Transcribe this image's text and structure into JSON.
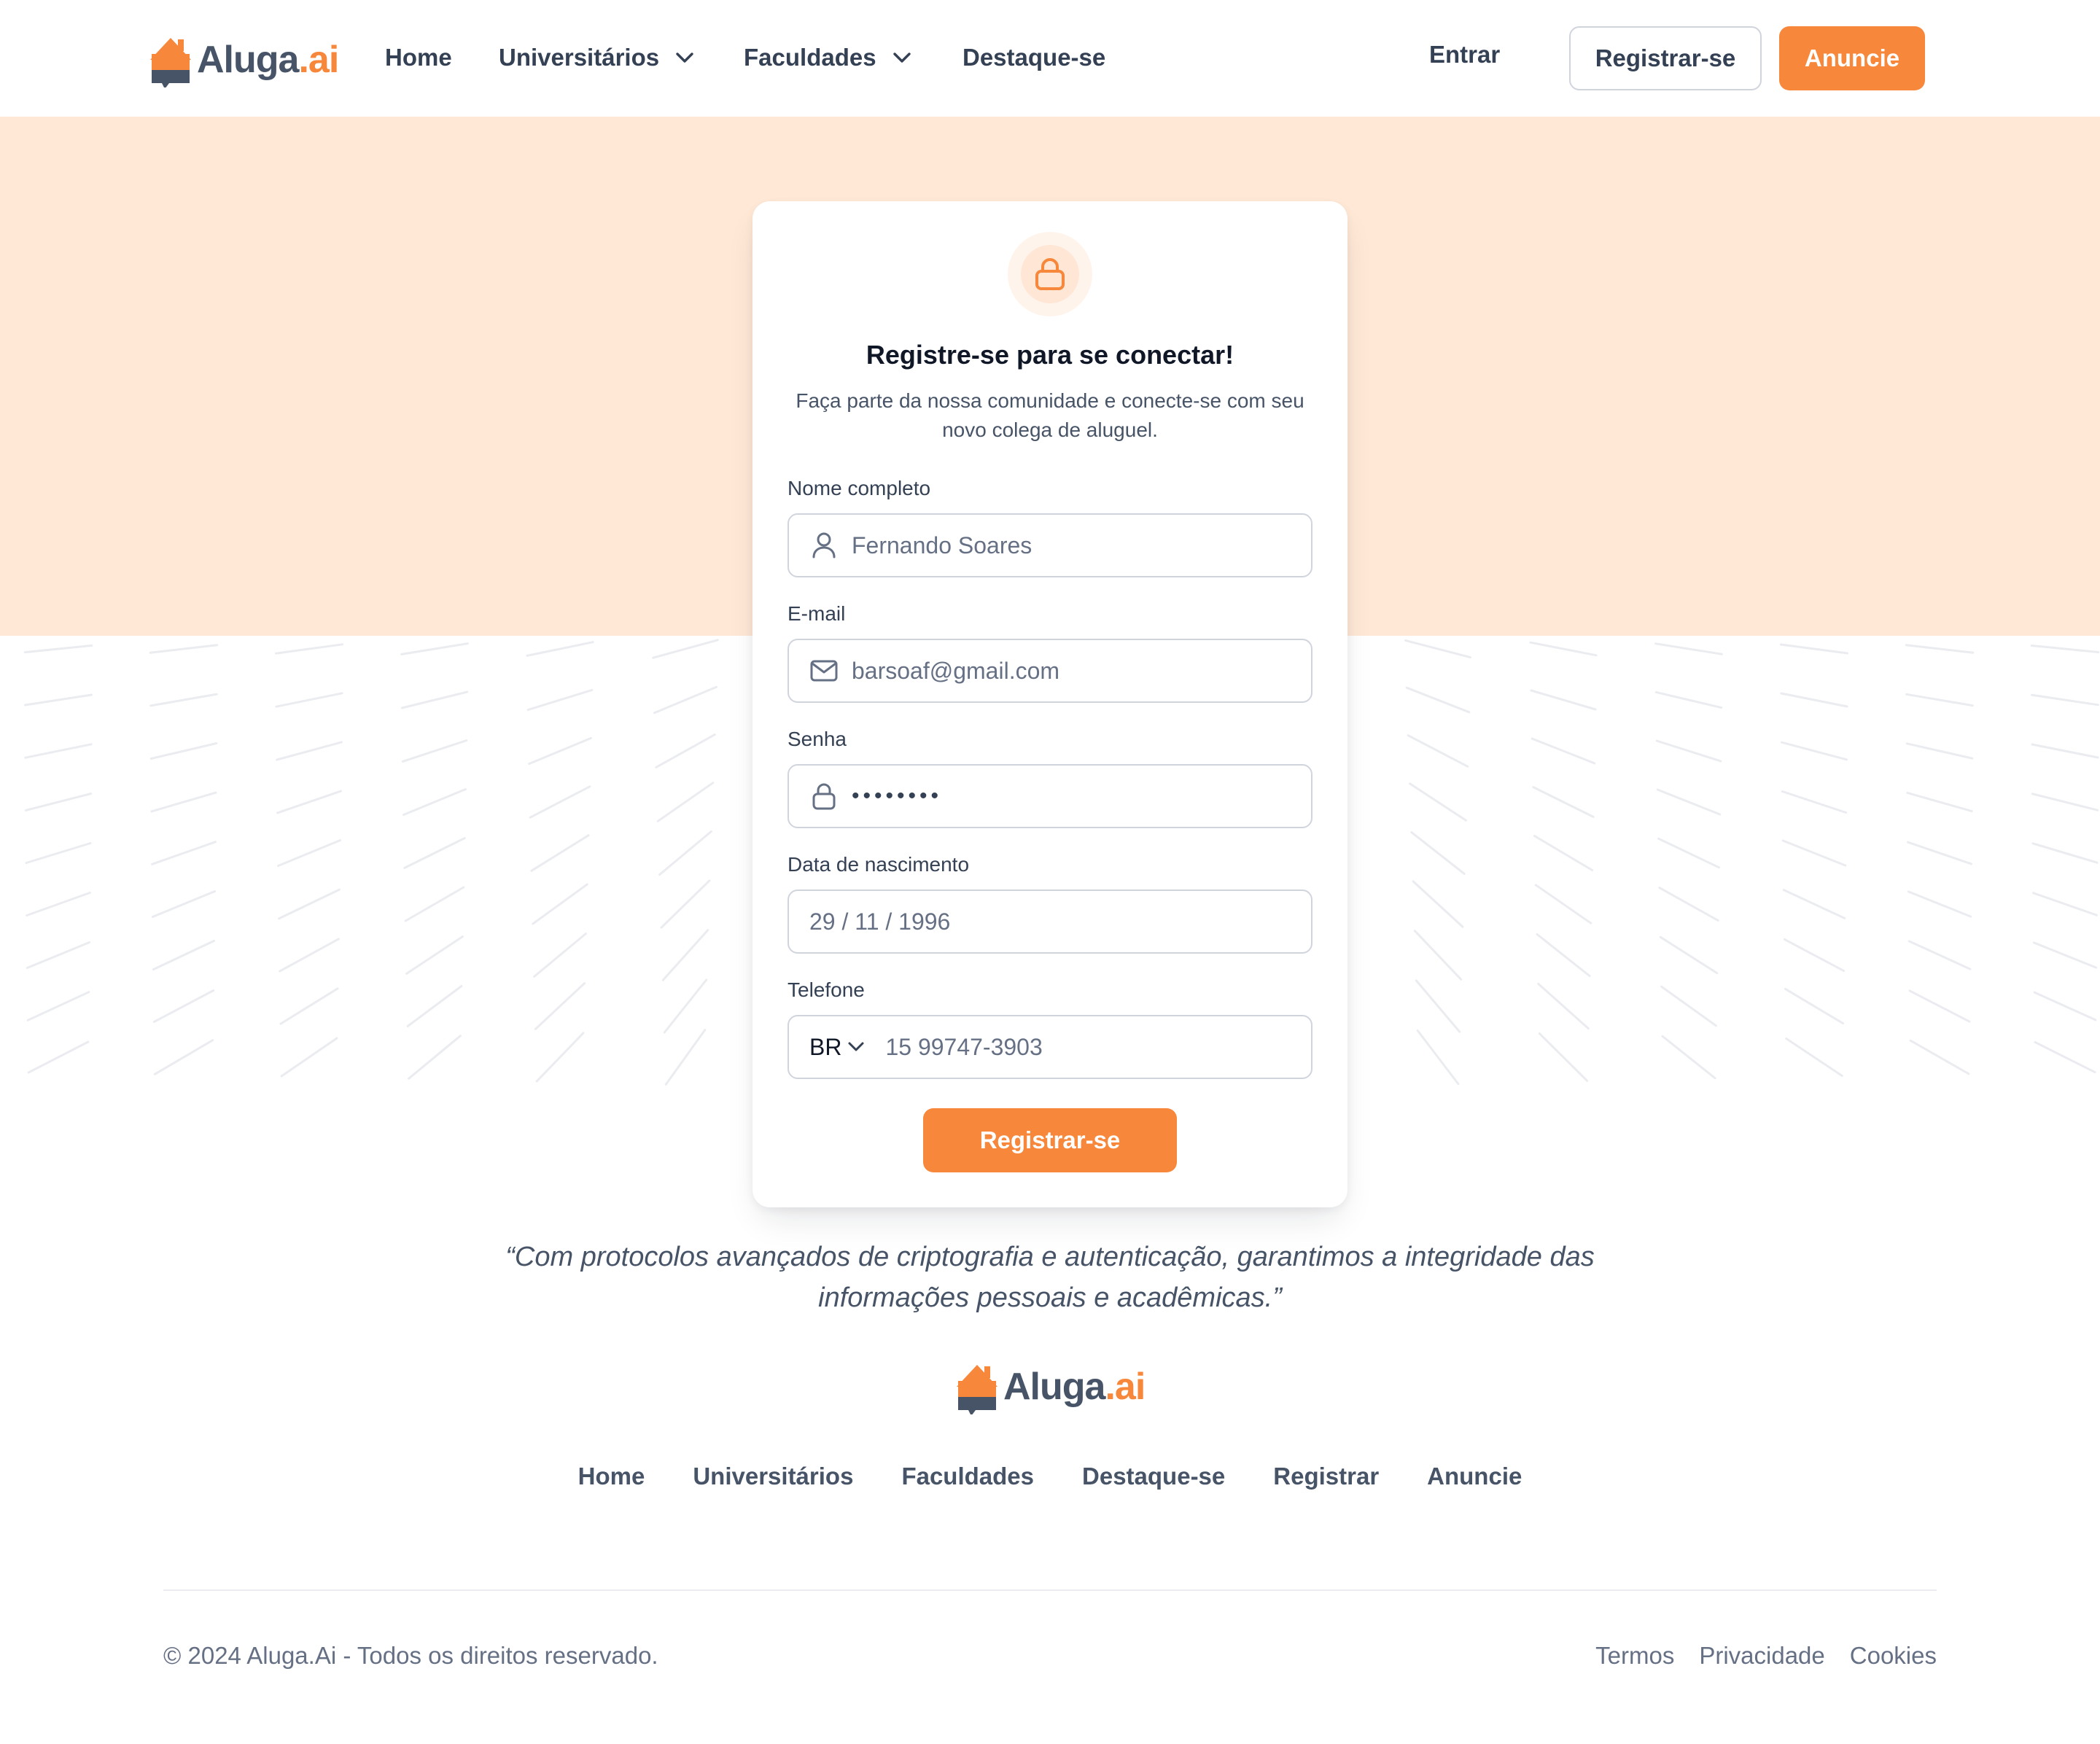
{
  "brand": {
    "name_main": "Aluga",
    "name_dot": ".ai",
    "accent_color": "#f7873b",
    "icon": "house-chat-logo-icon"
  },
  "header": {
    "nav": [
      {
        "label": "Home",
        "has_dropdown": false
      },
      {
        "label": "Universitários",
        "has_dropdown": true
      },
      {
        "label": "Faculdades",
        "has_dropdown": true
      },
      {
        "label": "Destaque-se",
        "has_dropdown": false
      }
    ],
    "login_label": "Entrar",
    "register_label": "Registrar-se",
    "advertise_label": "Anuncie"
  },
  "form": {
    "icon": "lock-icon",
    "title": "Registre-se para se conectar!",
    "subtitle": "Faça parte da nossa comunidade e conecte-se com seu novo colega de aluguel.",
    "name": {
      "label": "Nome completo",
      "value": "Fernando Soares",
      "icon": "user-icon"
    },
    "email": {
      "label": "E-mail",
      "value": "barsoaf@gmail.com",
      "icon": "mail-icon"
    },
    "password": {
      "label": "Senha",
      "value": "••••••••",
      "icon": "lock-icon"
    },
    "birthdate": {
      "label": "Data de nascimento",
      "value": "29 / 11 / 1996"
    },
    "phone": {
      "label": "Telefone",
      "country": "BR",
      "value": "15 99747-3903"
    },
    "submit_label": "Registrar-se"
  },
  "quote": "“Com protocolos avançados de criptografia e autenticação, garantimos a integridade das informações pessoais e acadêmicas.”",
  "footer": {
    "nav": [
      "Home",
      "Universitários",
      "Faculdades",
      "Destaque-se",
      "Registrar",
      "Anuncie"
    ],
    "copyright": "© 2024 Aluga.Ai - Todos os direitos reservado.",
    "legal": [
      "Termos",
      "Privacidade",
      "Cookies"
    ]
  }
}
